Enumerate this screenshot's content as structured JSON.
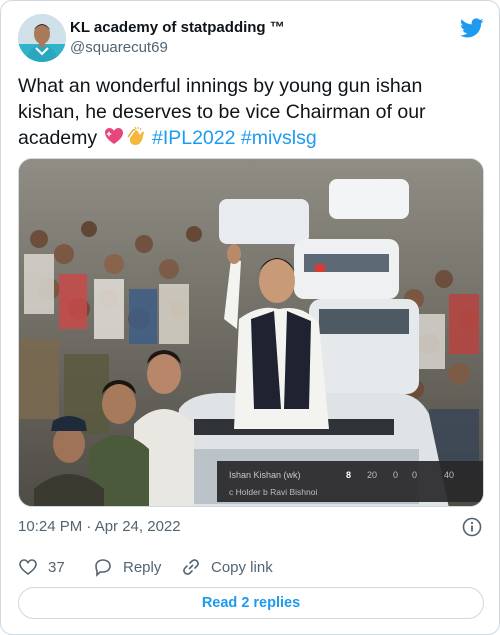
{
  "user": {
    "display_name": "KL academy of statpadding ™",
    "handle": "@squarecut69"
  },
  "tweet": {
    "text_main": "What an wonderful innings by young gun ishan kishan, he deserves to be vice Chairman of our academy ",
    "emojis": [
      "sparkling-heart-icon",
      "clapping-hands-icon"
    ],
    "hashtags": [
      "#IPL2022",
      "#mivslsg"
    ],
    "timestamp": "10:24 PM · Apr 24, 2022"
  },
  "scorecard": {
    "batter": "Ishan Kishan (wk)",
    "runs": "8",
    "balls": "20",
    "fours": "0",
    "sixes": "0",
    "strike_rate": "40",
    "dismissal": "c Holder b Ravi Bishnoi"
  },
  "actions": {
    "like_count": "37",
    "reply_label": "Reply",
    "copy_label": "Copy link",
    "read_replies_label": "Read 2 replies"
  },
  "colors": {
    "accent": "#1d9bf0",
    "muted": "#536471",
    "border": "#cfd9de"
  }
}
